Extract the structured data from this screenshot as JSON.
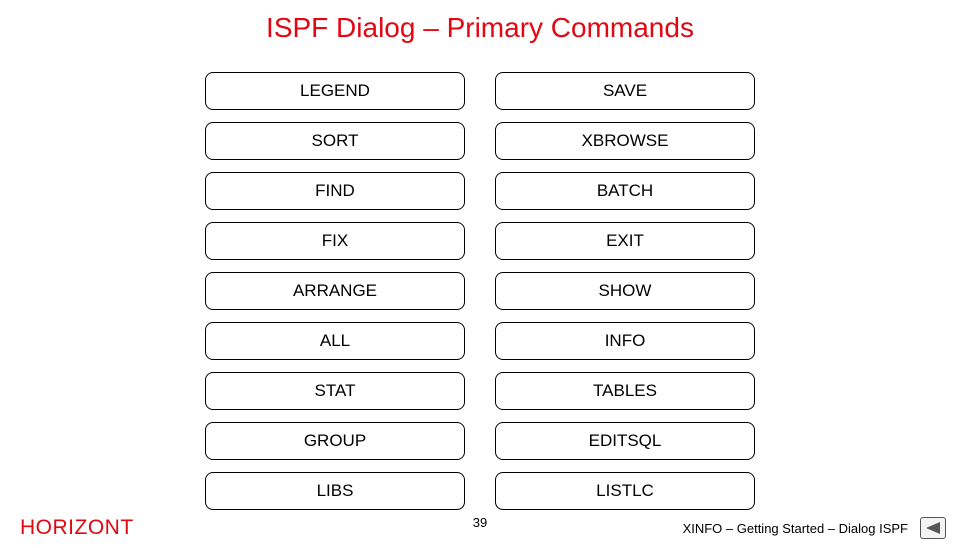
{
  "title": "ISPF Dialog – Primary Commands",
  "commands": {
    "left": [
      "LEGEND",
      "SORT",
      "FIND",
      "FIX",
      "ARRANGE",
      "ALL",
      "STAT",
      "GROUP",
      "LIBS"
    ],
    "right": [
      "SAVE",
      "XBROWSE",
      "BATCH",
      "EXIT",
      "SHOW",
      "INFO",
      "TABLES",
      "EDITSQL",
      "LISTLC"
    ]
  },
  "footer": {
    "brand": "HORIZONT",
    "page": "39",
    "doc": "XINFO – Getting Started – Dialog ISPF"
  }
}
